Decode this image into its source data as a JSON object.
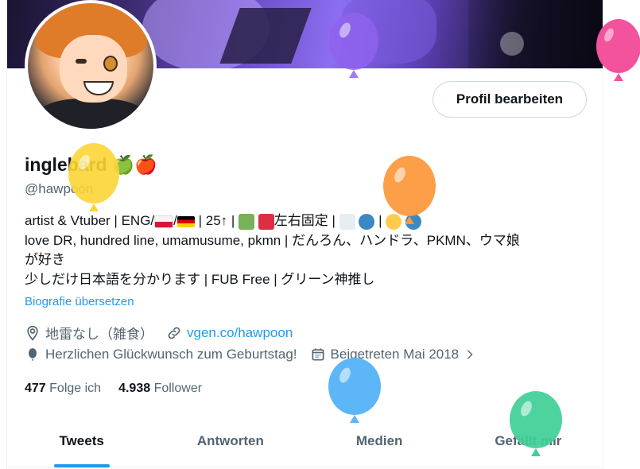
{
  "profile": {
    "edit_button": "Profil bearbeiten",
    "name": "inglebard",
    "name_emojis": "🍏🍎",
    "handle": "@hawpoon",
    "bio": {
      "line1_a": "artist & Vtuber | ENG/",
      "line1_b": "/",
      "line1_c": " | 25↑ | ",
      "line1_d": "左右固定 | ",
      "line1_e": " | ",
      "line2": "love DR, hundred line, umamusume, pkmn | だんろん、ハンドラ、PKMN、ウマ娘",
      "line3": "が好き",
      "line4": "少しだけ日本語を分かります | FUB Free | グリーン神推し"
    },
    "translate_link": "Biografie übersetzen",
    "location": "地雷なし（雑食）",
    "website": "vgen.co/hawpoon",
    "birthday": "Herzlichen Glückwunsch zum Geburtstag!",
    "joined": "Beigetreten Mai 2018",
    "following_count": "477",
    "following_label": "Folge ich",
    "followers_count": "4.938",
    "followers_label": "Follower"
  },
  "tabs": [
    {
      "label": "Tweets",
      "active": true
    },
    {
      "label": "Antworten",
      "active": false
    },
    {
      "label": "Medien",
      "active": false
    },
    {
      "label": "Gefällt mir",
      "active": false
    }
  ],
  "colors": {
    "accent": "#1d9bf0",
    "secondary_text": "#536471",
    "balloon_yellow": "#fbd534",
    "balloon_orange": "#fd9a3e",
    "balloon_blue": "#5cb6f7",
    "balloon_green": "#3fcf97",
    "balloon_purple": "#8e63ee",
    "balloon_pink": "#f3529c"
  }
}
